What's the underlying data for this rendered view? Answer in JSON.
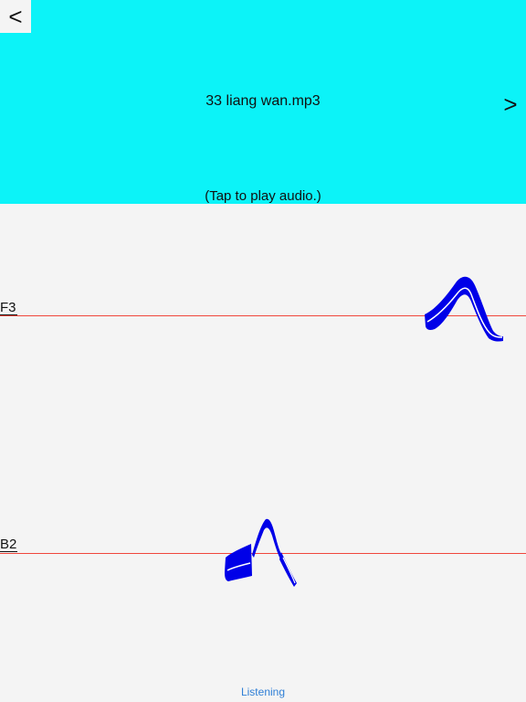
{
  "header": {
    "back_label": "<",
    "next_label": ">",
    "file_title": "33 liang wan.mp3",
    "tap_hint": "(Tap to play audio.)"
  },
  "reference_lines": [
    {
      "note": "F3"
    },
    {
      "note": "B2"
    }
  ],
  "colors": {
    "header_bg": "#0cf3f8",
    "canvas_bg": "#f4f4f4",
    "reference_line": "#f0463c",
    "pitch_trace": "#0000e8",
    "status_text": "#2f7fd6"
  },
  "status": {
    "label": "Listening"
  }
}
